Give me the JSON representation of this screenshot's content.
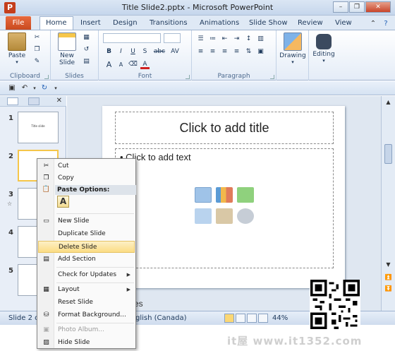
{
  "window": {
    "title": "Title Slide2.pptx - Microsoft PowerPoint",
    "app_icon_letter": "P",
    "minimize": "–",
    "restore": "❐",
    "close": "✕"
  },
  "tabs": {
    "file": "File",
    "items": [
      "Home",
      "Insert",
      "Design",
      "Transitions",
      "Animations",
      "Slide Show",
      "Review",
      "View"
    ],
    "active": "Home"
  },
  "ribbon": {
    "groups": {
      "clipboard": "Clipboard",
      "slides": "Slides",
      "font": "Font",
      "paragraph": "Paragraph"
    },
    "paste_label": "Paste",
    "new_slide_label": "New Slide",
    "drawing_label": "Drawing",
    "editing_label": "Editing",
    "font_buttons": [
      "B",
      "I",
      "U",
      "S",
      "abc",
      "AV"
    ],
    "font_size_buttons": [
      "A",
      "A"
    ]
  },
  "slide_panel": {
    "thumbnails": [
      {
        "number": "1",
        "text": "Title slide"
      },
      {
        "number": "2",
        "text": ""
      },
      {
        "number": "3",
        "text": ""
      },
      {
        "number": "4",
        "text": ""
      },
      {
        "number": "5",
        "text": ""
      }
    ]
  },
  "slide": {
    "title_placeholder": "Click to add title",
    "content_placeholder": "• Click to add text"
  },
  "notes": {
    "text": "es"
  },
  "context_menu": {
    "cut": "Cut",
    "copy": "Copy",
    "paste_options": "Paste Options:",
    "paste_keep": "A",
    "new_slide": "New Slide",
    "duplicate_slide": "Duplicate Slide",
    "delete_slide": "Delete Slide",
    "add_section": "Add Section",
    "check_updates": "Check for Updates",
    "layout": "Layout",
    "reset_slide": "Reset Slide",
    "format_background": "Format Background...",
    "photo_album": "Photo Album...",
    "hide_slide": "Hide Slide"
  },
  "statusbar": {
    "slide_info": "Slide 2 of",
    "language": "glish (Canada)",
    "zoom": "44%"
  },
  "watermark": "it屋 www.it1352.com",
  "colors": {
    "file_tab": "#c94a1f",
    "highlight": "#fbdc84",
    "ribbon_bg": "#e4ecf7"
  }
}
